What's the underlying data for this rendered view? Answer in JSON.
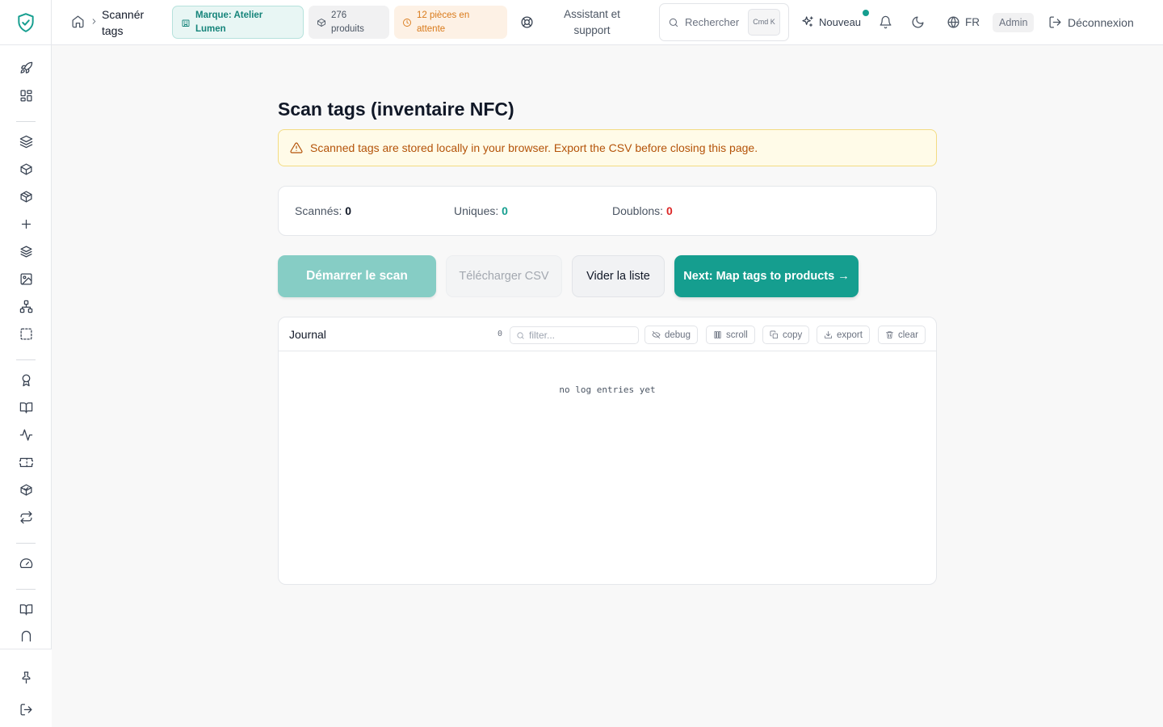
{
  "app": {
    "accent_color": "#159e8f"
  },
  "sidebar": {
    "items": [
      {
        "icon": "rocket-icon"
      },
      {
        "icon": "dashboard-icon"
      },
      {
        "icon": "layers-icon"
      },
      {
        "icon": "box-icon"
      },
      {
        "icon": "package-icon"
      },
      {
        "icon": "plus-icon"
      },
      {
        "icon": "stack-icon"
      },
      {
        "icon": "image-icon"
      },
      {
        "icon": "hierarchy-icon"
      },
      {
        "icon": "scan-frame-icon"
      },
      {
        "icon": "award-icon"
      },
      {
        "icon": "book-icon"
      },
      {
        "icon": "activity-icon"
      },
      {
        "icon": "ticket-icon"
      },
      {
        "icon": "package-check-icon"
      },
      {
        "icon": "repeat-icon"
      },
      {
        "icon": "gauge-icon"
      },
      {
        "icon": "book-open-icon"
      },
      {
        "icon": "arch-icon"
      }
    ],
    "footer": [
      {
        "icon": "pin-icon"
      },
      {
        "icon": "logout-icon"
      }
    ]
  },
  "topbar": {
    "breadcrumb_title": "Scannér tags",
    "brand_pill": "Marque: Atelier Lumen",
    "products_pill": "276 produits",
    "pending_pill": "12 pièces en attente",
    "support": "Assistant et support",
    "search_placeholder": "Rechercher",
    "search_shortcut": "Cmd K",
    "new_label": "Nouveau",
    "language": "FR",
    "role": "Admin",
    "logout": "Déconnexion"
  },
  "main": {
    "title": "Scan tags (inventaire NFC)",
    "alert": "Scanned tags are stored locally in your browser. Export the CSV before closing this page.",
    "stats": {
      "scanned_label": "Scannés:",
      "scanned_value": "0",
      "unique_label": "Uniques:",
      "unique_value": "0",
      "duplicates_label": "Doublons:",
      "duplicates_value": "0"
    },
    "buttons": {
      "start": "Démarrer le scan",
      "download_csv": "Télécharger CSV",
      "clear_list": "Vider la liste",
      "next": "Next: Map tags to products →"
    },
    "journal": {
      "title": "Journal",
      "count": "0",
      "filter_placeholder": "filter...",
      "debug": "debug",
      "scroll": "scroll",
      "copy": "copy",
      "export": "export",
      "clear": "clear",
      "empty": "no log entries yet"
    }
  }
}
